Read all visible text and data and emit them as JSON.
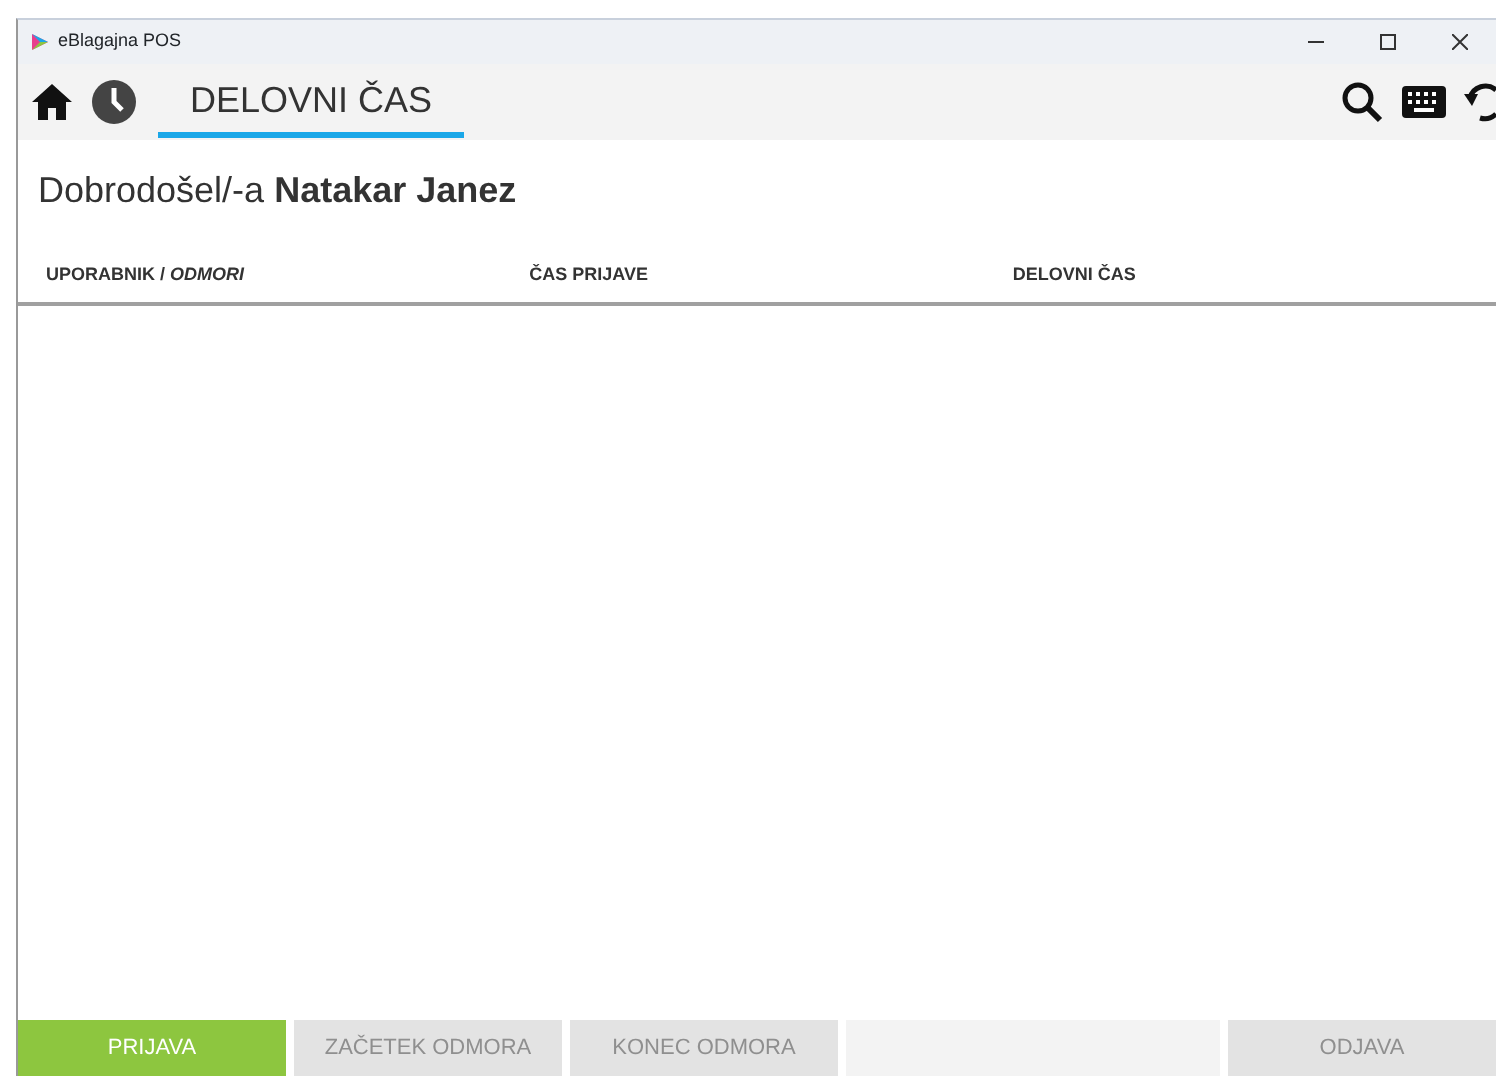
{
  "window": {
    "title": "eBlagajna POS"
  },
  "toolbar": {
    "tab": {
      "label": "DELOVNI ČAS",
      "selected": true
    }
  },
  "greeting": {
    "text": "Dobrodošel/-a",
    "name": "Natakar Janez"
  },
  "table": {
    "columns": [
      {
        "label": "UPORABNIK / *ODMORI*"
      },
      {
        "label": "ČAS PRIJAVE"
      },
      {
        "label": "DELOVNI ČAS"
      }
    ]
  },
  "actions": [
    {
      "label": "PRIJAVA",
      "disabled": false,
      "kind": "button"
    },
    {
      "label": "ZAČETEK ODMORA",
      "disabled": true,
      "kind": "button"
    },
    {
      "label": "KONEC ODMORA",
      "disabled": true,
      "kind": "button"
    },
    {
      "kind": "spacer"
    },
    {
      "label": "ODJAVA",
      "disabled": true,
      "kind": "button"
    }
  ]
}
